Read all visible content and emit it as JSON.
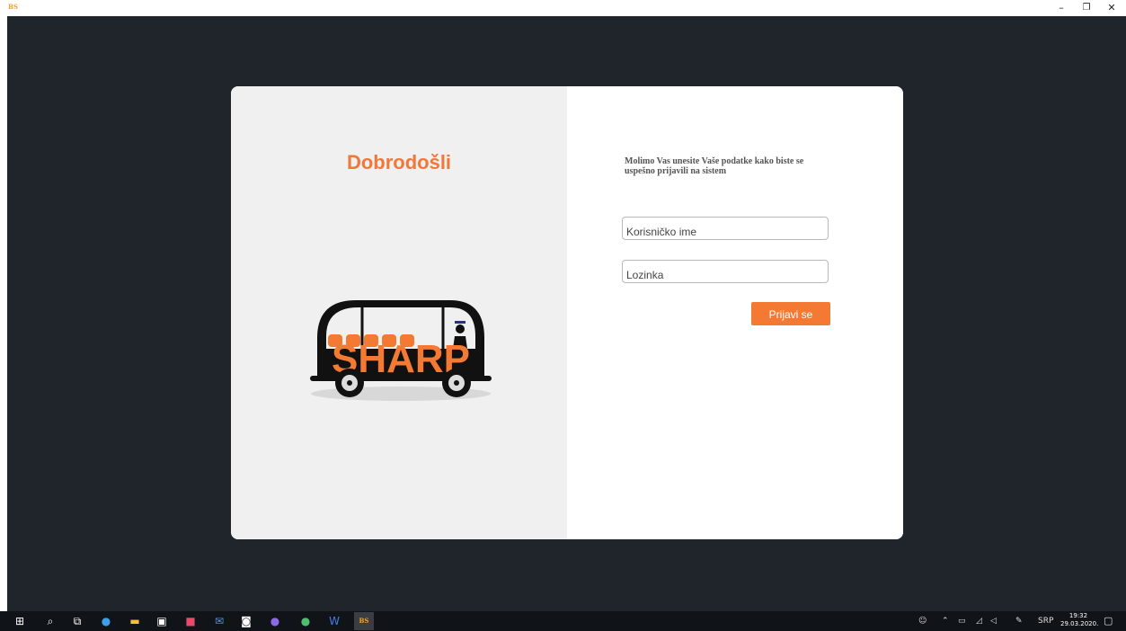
{
  "window": {
    "app_icon_label": "BS",
    "controls": {
      "minimize": "–",
      "maximize": "❐",
      "close": "✕"
    }
  },
  "welcome": {
    "title": "Dobrodošli"
  },
  "logo": {
    "text": "SHARP"
  },
  "form": {
    "instruction": "Molimo Vas unesite Vaše podatke kako biste se uspešno prijavili na sistem",
    "username_placeholder": "Korisničko ime",
    "password_placeholder": "Lozinka",
    "login_label": "Prijavi se"
  },
  "taskbar": {
    "app_label": "BS",
    "tray": {
      "language": "SRP"
    },
    "clock": {
      "time": "19:32",
      "date": "29.03.2020."
    }
  },
  "colors": {
    "accent": "#f47a34",
    "desktop": "#1f252b",
    "pane": "#f0f0f0"
  }
}
